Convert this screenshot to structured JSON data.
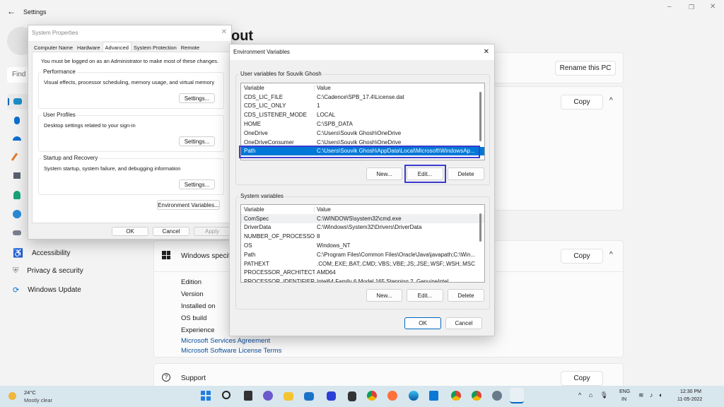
{
  "settings": {
    "title": "Settings",
    "search_placeholder": "Find",
    "header_partial": "out",
    "sidebar": [
      {
        "label": "Accessibility",
        "icon": "accessibility-icon"
      },
      {
        "label": "Privacy & security",
        "icon": "shield-icon"
      },
      {
        "label": "Windows Update",
        "icon": "update-icon"
      }
    ],
    "rename_label": "Rename this PC",
    "copy_label": "Copy",
    "winspec_label": "Windows specifications",
    "spec_rows": [
      "Edition",
      "Version",
      "Installed on",
      "OS build",
      "Experience"
    ],
    "links": [
      "Microsoft Services Agreement",
      "Microsoft Software License Terms"
    ],
    "support_label": "Support"
  },
  "sysprops": {
    "title": "System Properties",
    "tabs": [
      "Computer Name",
      "Hardware",
      "Advanced",
      "System Protection",
      "Remote"
    ],
    "active_tab": "Advanced",
    "admin_note": "You must be logged on as an Administrator to make most of these changes.",
    "groups": [
      {
        "label": "Performance",
        "desc": "Visual effects, processor scheduling, memory usage, and virtual memory",
        "button": "Settings..."
      },
      {
        "label": "User Profiles",
        "desc": "Desktop settings related to your sign-in",
        "button": "Settings..."
      },
      {
        "label": "Startup and Recovery",
        "desc": "System startup, system failure, and debugging information",
        "button": "Settings..."
      }
    ],
    "env_button": "Environment Variables...",
    "ok": "OK",
    "cancel": "Cancel",
    "apply": "Apply"
  },
  "envvars": {
    "title": "Environment Variables",
    "user_group": "User variables for Souvik Ghosh",
    "system_group": "System variables",
    "col_variable": "Variable",
    "col_value": "Value",
    "user_rows": [
      [
        "CDS_LIC_FILE",
        "C:\\Cadence\\SPB_17.4\\License.dat"
      ],
      [
        "CDS_LIC_ONLY",
        "1"
      ],
      [
        "CDS_LISTENER_MODE",
        "LOCAL"
      ],
      [
        "HOME",
        "C:\\SPB_DATA"
      ],
      [
        "OneDrive",
        "C:\\Users\\Souvik Ghosh\\OneDrive"
      ],
      [
        "OneDriveConsumer",
        "C:\\Users\\Souvik Ghosh\\OneDrive"
      ],
      [
        "Path",
        "C:\\Users\\Souvik Ghosh\\AppData\\Local\\Microsoft\\WindowsAp..."
      ]
    ],
    "selected_user_row": "Path",
    "system_rows": [
      [
        "ComSpec",
        "C:\\WINDOWS\\system32\\cmd.exe"
      ],
      [
        "DriverData",
        "C:\\Windows\\System32\\Drivers\\DriverData"
      ],
      [
        "NUMBER_OF_PROCESSORS",
        "8"
      ],
      [
        "OS",
        "Windows_NT"
      ],
      [
        "Path",
        "C:\\Program Files\\Common Files\\Oracle\\Java\\javapath;C:\\Win..."
      ],
      [
        "PATHEXT",
        ".COM;.EXE;.BAT;.CMD;.VBS;.VBE;.JS;.JSE;.WSF;.WSH;.MSC"
      ],
      [
        "PROCESSOR_ARCHITECTU...",
        "AMD64"
      ],
      [
        "PROCESSOR_IDENTIFIER",
        "Intel64 Family 6 Model 165 Stepping 2, GenuineIntel"
      ]
    ],
    "new": "New...",
    "edit": "Edit...",
    "delete": "Delete",
    "ok": "OK",
    "cancel": "Cancel",
    "highlight_color": "#3b3bd0"
  },
  "taskbar": {
    "temp": "24°C",
    "weather": "Mostly clear",
    "lang1": "ENG",
    "lang2": "IN",
    "time": "12:30 PM",
    "date": "11-05-2022"
  }
}
